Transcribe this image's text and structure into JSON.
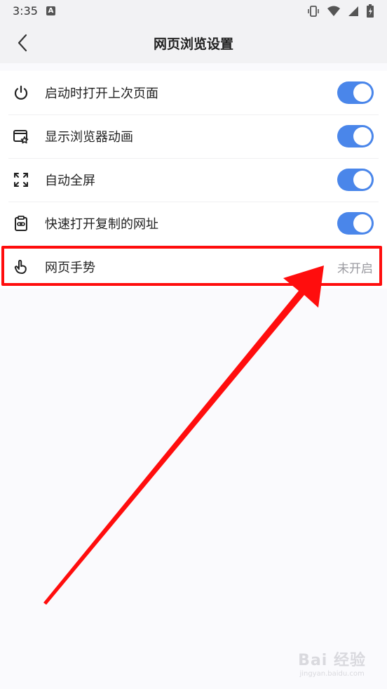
{
  "status_bar": {
    "time": "3:35",
    "notification_badge": "A",
    "icons": [
      "vibrate-icon",
      "wifi-icon",
      "signal-icon",
      "battery-icon"
    ]
  },
  "header": {
    "title": "网页浏览设置",
    "back_icon": "chevron-left-icon"
  },
  "settings": [
    {
      "label": "启动时打开上次页面",
      "icon": "power-icon",
      "toggle": true
    },
    {
      "label": "显示浏览器动画",
      "icon": "browser-star-icon",
      "toggle": true
    },
    {
      "label": "自动全屏",
      "icon": "fullscreen-icon",
      "toggle": true
    },
    {
      "label": "快速打开复制的网址",
      "icon": "clipboard-link-icon",
      "toggle": true
    },
    {
      "label": "网页手势",
      "icon": "gesture-hand-icon",
      "value": "未开启"
    }
  ],
  "colors": {
    "toggle_on": "#4a86ea",
    "annotation": "#ff0d0d",
    "header_bg": "#f2f2f4"
  },
  "watermark": {
    "main": "Bai 经验",
    "sub": "jingyan.baidu.com"
  }
}
